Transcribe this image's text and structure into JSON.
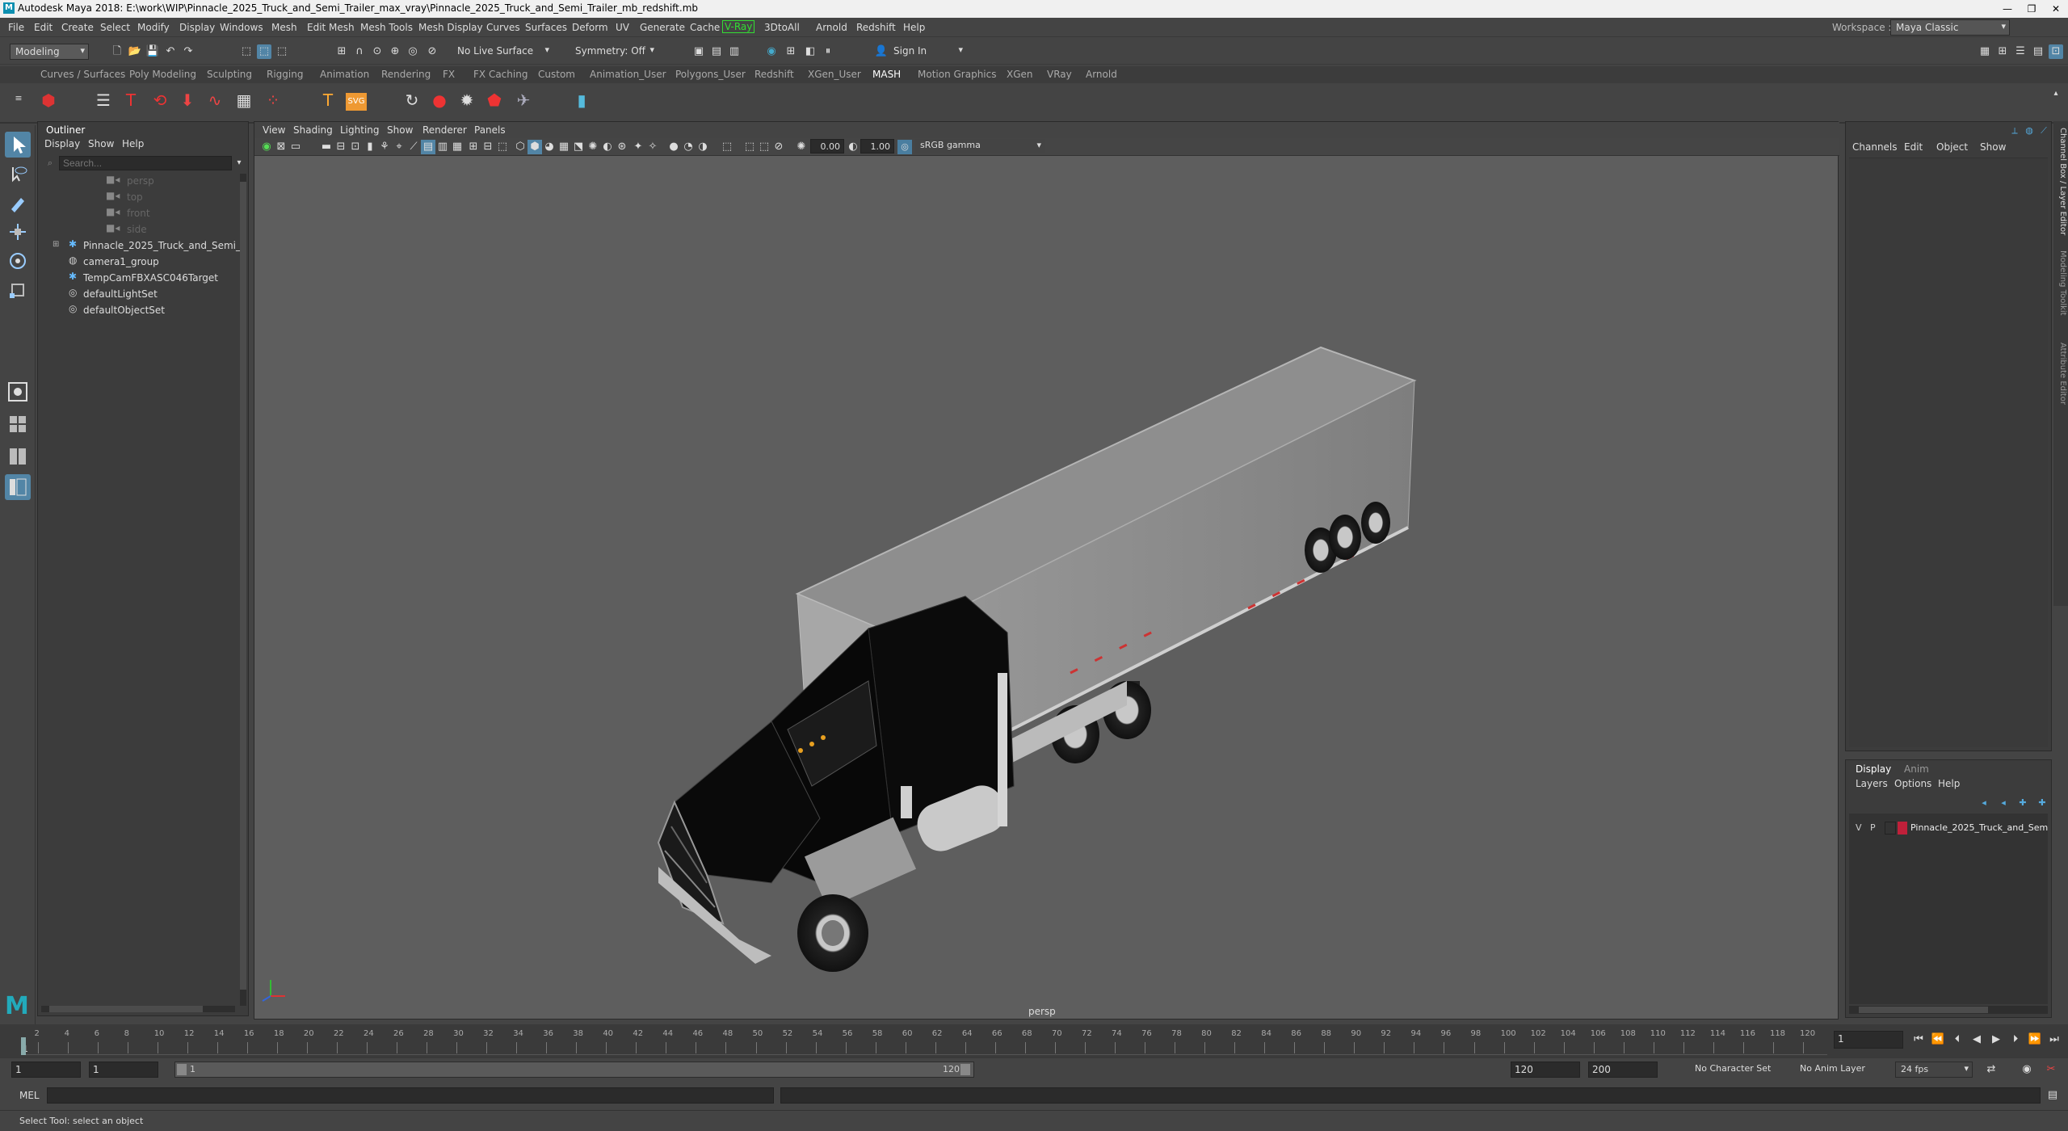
{
  "window": {
    "title": "Autodesk Maya 2018: E:\\work\\WIP\\Pinnacle_2025_Truck_and_Semi_Trailer_max_vray\\Pinnacle_2025_Truck_and_Semi_Trailer_mb_redshift.mb",
    "logo": "M",
    "min": "—",
    "restore": "❐",
    "close": "✕"
  },
  "menu": [
    "File",
    "Edit",
    "Create",
    "Select",
    "Modify",
    "Display",
    "Windows",
    "Mesh",
    "Edit Mesh",
    "Mesh Tools",
    "Mesh Display",
    "Curves",
    "Surfaces",
    "Deform",
    "UV",
    "Generate",
    "Cache",
    "V-Ray",
    "3DtoAll",
    "Arnold",
    "Redshift",
    "Help"
  ],
  "workspace": {
    "label": "Workspace :",
    "value": "Maya Classic"
  },
  "statusline": {
    "mode": "Modeling",
    "live_surface": "No Live Surface",
    "symmetry": "Symmetry: Off",
    "sign_in": "Sign In"
  },
  "shelf_tabs": [
    "Curves / Surfaces",
    "Poly Modeling",
    "Sculpting",
    "Rigging",
    "Animation",
    "Rendering",
    "FX",
    "FX Caching",
    "Custom",
    "Animation_User",
    "Polygons_User",
    "Redshift",
    "XGen_User",
    "MASH",
    "Motion Graphics",
    "XGen",
    "VRay",
    "Arnold"
  ],
  "active_shelf": "MASH",
  "outliner": {
    "title": "Outliner",
    "menu": [
      "Display",
      "Show",
      "Help"
    ],
    "search_placeholder": "Search...",
    "items": [
      {
        "label": "persp",
        "type": "camera",
        "dim": true
      },
      {
        "label": "top",
        "type": "camera",
        "dim": true
      },
      {
        "label": "front",
        "type": "camera",
        "dim": true
      },
      {
        "label": "side",
        "type": "camera",
        "dim": true
      },
      {
        "label": "Pinnacle_2025_Truck_and_Semi_Traile",
        "type": "group",
        "dim": false
      },
      {
        "label": "camera1_group",
        "type": "group",
        "dim": false
      },
      {
        "label": "TempCamFBXASC046Target",
        "type": "locator",
        "dim": false
      },
      {
        "label": "defaultLightSet",
        "type": "set",
        "dim": false
      },
      {
        "label": "defaultObjectSet",
        "type": "set",
        "dim": false
      }
    ]
  },
  "viewport": {
    "menu": [
      "View",
      "Shading",
      "Lighting",
      "Show",
      "Renderer",
      "Panels"
    ],
    "exposure": "0.00",
    "gamma": "1.00",
    "colorspace": "sRGB gamma",
    "camera_label": "persp"
  },
  "channelbox": {
    "menu": [
      "Channels",
      "Edit",
      "Object",
      "Show"
    ]
  },
  "side_tabs": [
    "Channel Box / Layer Editor",
    "Modeling Toolkit",
    "Attribute Editor"
  ],
  "layers": {
    "tabs": [
      "Display",
      "Anim"
    ],
    "menu": [
      "Layers",
      "Options",
      "Help"
    ],
    "layer": {
      "v": "V",
      "p": "P",
      "name": "Pinnacle_2025_Truck_and_Sem",
      "color": "#c0203a"
    }
  },
  "timeline": {
    "ticks": [
      "2",
      "4",
      "6",
      "8",
      "10",
      "12",
      "14",
      "16",
      "18",
      "20",
      "22",
      "24",
      "26",
      "28",
      "30",
      "32",
      "34",
      "36",
      "38",
      "40",
      "42",
      "44",
      "46",
      "48",
      "50",
      "52",
      "54",
      "56",
      "58",
      "60",
      "62",
      "64",
      "66",
      "68",
      "70",
      "72",
      "74",
      "76",
      "78",
      "80",
      "82",
      "84",
      "86",
      "88",
      "90",
      "92",
      "94",
      "96",
      "98",
      "100",
      "102",
      "104",
      "106",
      "108",
      "110",
      "112",
      "114",
      "116",
      "118",
      "120"
    ],
    "first_tick": "1",
    "current_frame": "1"
  },
  "range": {
    "start": "1",
    "playback_start": "1",
    "slider_start": "1",
    "slider_end": "120",
    "playback_end": "120",
    "end": "200",
    "character_set": "No Character Set",
    "anim_layer": "No Anim Layer",
    "fps": "24 fps"
  },
  "command": {
    "label": "MEL"
  },
  "help_line": "Select Tool: select an object"
}
